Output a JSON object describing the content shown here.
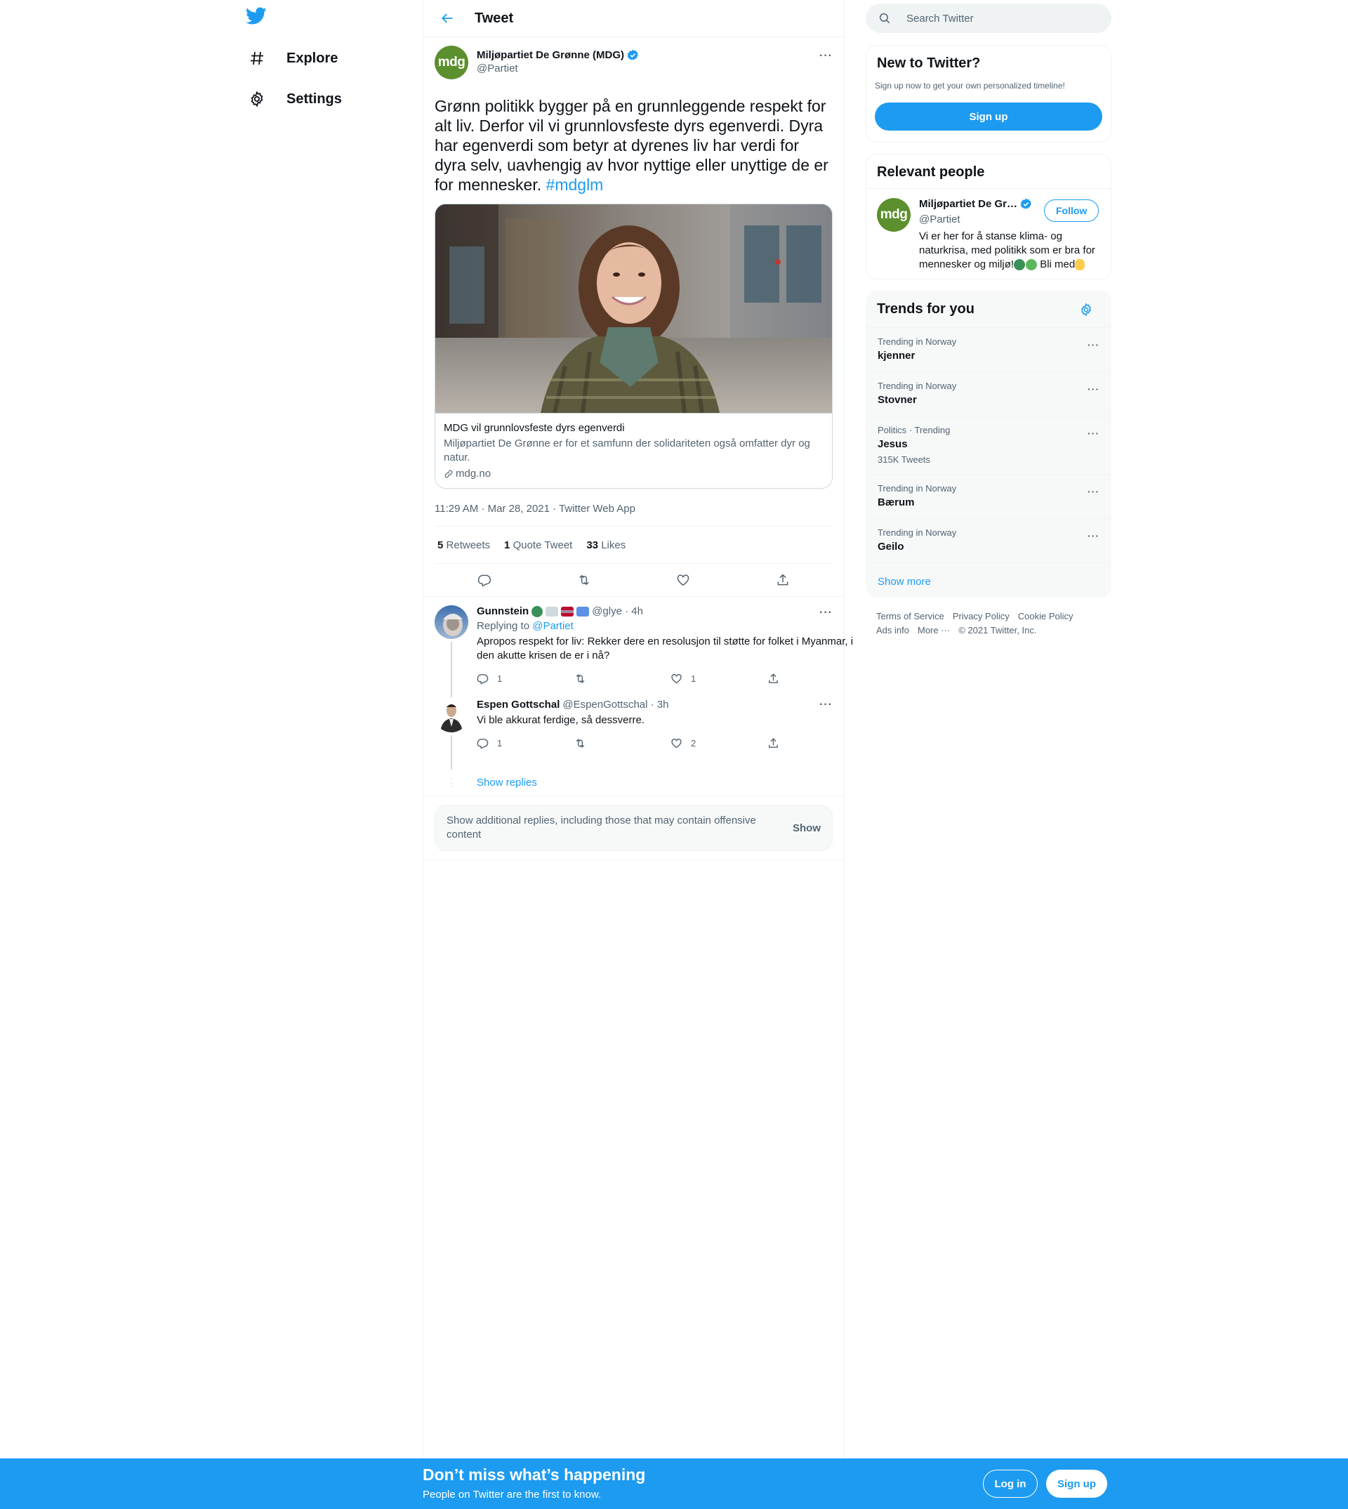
{
  "nav": {
    "explore": "Explore",
    "settings": "Settings"
  },
  "header": {
    "title": "Tweet"
  },
  "tweet": {
    "avatar_text": "mdg",
    "author_name": "Miljøpartiet De Grønne (MDG)",
    "author_handle": "@Partiet",
    "text": "Grønn politikk bygger på en grunnleggende respekt for alt liv. Derfor vil vi grunnlovsfeste dyrs egenverdi. Dyra har egenverdi som betyr at dyrenes liv har verdi for dyra selv, uavhengig av hvor nyttige eller unyttige de er for mennesker.",
    "hashtag": "#mdglm",
    "card": {
      "title": "MDG vil grunnlovsfeste dyrs egenverdi",
      "description": "Miljøpartiet De Grønne er for et samfunn der solidariteten også omfatter dyr og natur.",
      "domain": "mdg.no"
    },
    "timestamp": "11:29 AM · Mar 28, 2021 · Twitter Web App",
    "stats": {
      "retweets_count": "5",
      "retweets_label": "Retweets",
      "quotes_count": "1",
      "quotes_label": "Quote Tweet",
      "likes_count": "33",
      "likes_label": "Likes"
    }
  },
  "replies": [
    {
      "name": "Gunnstein",
      "handle": "@glye · 4h",
      "replying_prefix": "Replying to",
      "replying_to": "@Partiet",
      "text": "Apropos respekt for liv: Rekker dere en resolusjon til støtte for folket i Myanmar, i den akutte krisen de er i nå?",
      "reply_count": "1",
      "retweet_count": "",
      "like_count": "1"
    },
    {
      "name": "Espen Gottschal",
      "handle": "@EspenGottschal · 3h",
      "text": "Vi ble akkurat ferdige, så dessverre.",
      "reply_count": "1",
      "retweet_count": "",
      "like_count": "2"
    }
  ],
  "show_replies": "Show replies",
  "additional": {
    "text": "Show additional replies, including those that may contain offensive content",
    "button": "Show"
  },
  "search": {
    "placeholder": "Search Twitter"
  },
  "new_to_twitter": {
    "title": "New to Twitter?",
    "subtitle": "Sign up now to get your own personalized timeline!",
    "button": "Sign up"
  },
  "relevant": {
    "title": "Relevant people",
    "avatar_text": "mdg",
    "name": "Miljøpartiet De Gr…",
    "handle": "@Partiet",
    "follow": "Follow",
    "bio_line1": "Vi er her for å stanse klima- og naturkrisa, med politikk som er bra for mennesker og miljø!",
    "bio_line2": "Bli med"
  },
  "trends": {
    "title": "Trends for you",
    "items": [
      {
        "context": "Trending in Norway",
        "name": "kjenner",
        "count": ""
      },
      {
        "context": "Trending in Norway",
        "name": "Stovner",
        "count": ""
      },
      {
        "context": "Politics · Trending",
        "name": "Jesus",
        "count": "315K Tweets"
      },
      {
        "context": "Trending in Norway",
        "name": "Bærum",
        "count": ""
      },
      {
        "context": "Trending in Norway",
        "name": "Geilo",
        "count": ""
      }
    ],
    "show_more": "Show more"
  },
  "footer": {
    "terms": "Terms of Service",
    "privacy": "Privacy Policy",
    "cookie": "Cookie Policy",
    "ads": "Ads info",
    "more": "More ···",
    "copyright": "© 2021 Twitter, Inc."
  },
  "bottom_bar": {
    "title": "Don’t miss what’s happening",
    "subtitle": "People on Twitter are the first to know.",
    "login": "Log in",
    "signup": "Sign up"
  },
  "colors": {
    "accent": "#1d9bf0",
    "mdg_green": "#5c8f2d",
    "text": "#0f1419",
    "muted": "#536471"
  }
}
